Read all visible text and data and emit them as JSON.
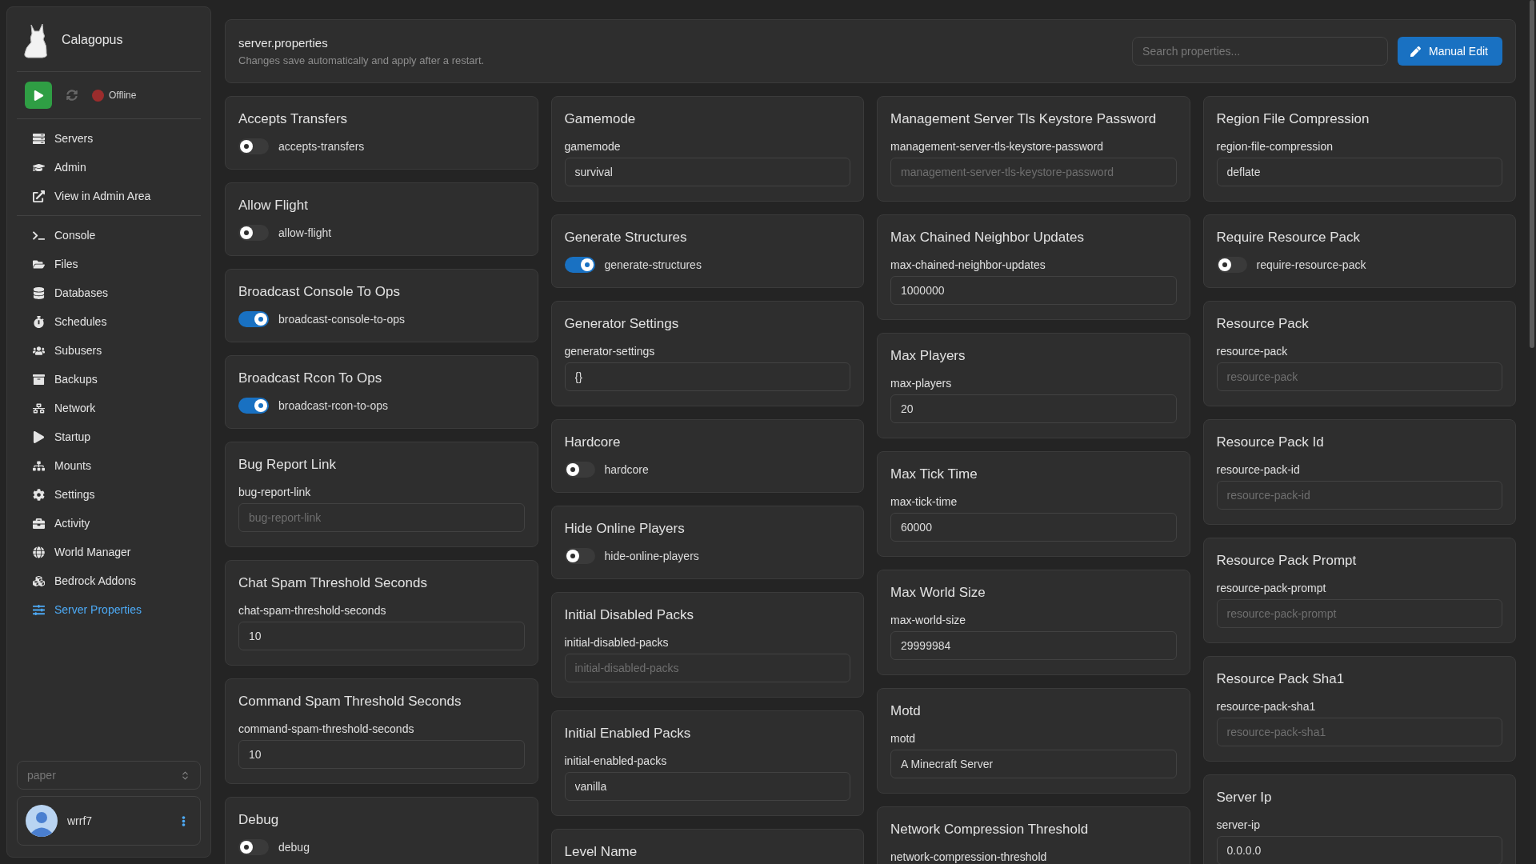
{
  "brand": "Calagopus",
  "power": {
    "status": "Offline"
  },
  "nav_groups": [
    [
      {
        "label": "Servers",
        "selected": false
      },
      {
        "label": "Admin",
        "selected": false
      },
      {
        "label": "View in Admin Area",
        "selected": false
      }
    ],
    [
      {
        "label": "Console",
        "selected": false
      },
      {
        "label": "Files",
        "selected": false
      },
      {
        "label": "Databases",
        "selected": false
      },
      {
        "label": "Schedules",
        "selected": false
      },
      {
        "label": "Subusers",
        "selected": false
      },
      {
        "label": "Backups",
        "selected": false
      },
      {
        "label": "Network",
        "selected": false
      },
      {
        "label": "Startup",
        "selected": false
      },
      {
        "label": "Mounts",
        "selected": false
      },
      {
        "label": "Settings",
        "selected": false
      },
      {
        "label": "Activity",
        "selected": false
      },
      {
        "label": "World Manager",
        "selected": false
      },
      {
        "label": "Bedrock Addons",
        "selected": false
      },
      {
        "label": "Server Properties",
        "selected": true
      }
    ]
  ],
  "server_select": {
    "placeholder": "paper"
  },
  "user": {
    "name": "wrrf7"
  },
  "header": {
    "title": "server.properties",
    "subtitle": "Changes save automatically and apply after a restart.",
    "search_placeholder": "Search properties...",
    "button": "Manual Edit"
  },
  "columns": [
    [
      {
        "kind": "toggle",
        "title": "Accepts Transfers",
        "key": "accepts-transfers",
        "on": false
      },
      {
        "kind": "toggle",
        "title": "Allow Flight",
        "key": "allow-flight",
        "on": false
      },
      {
        "kind": "toggle",
        "title": "Broadcast Console To Ops",
        "key": "broadcast-console-to-ops",
        "on": true
      },
      {
        "kind": "toggle",
        "title": "Broadcast Rcon To Ops",
        "key": "broadcast-rcon-to-ops",
        "on": true
      },
      {
        "kind": "text",
        "title": "Bug Report Link",
        "key": "bug-report-link",
        "placeholder": "bug-report-link"
      },
      {
        "kind": "text",
        "title": "Chat Spam Threshold Seconds",
        "key": "chat-spam-threshold-seconds",
        "value": "10"
      },
      {
        "kind": "text",
        "title": "Command Spam Threshold Seconds",
        "key": "command-spam-threshold-seconds",
        "value": "10"
      },
      {
        "kind": "toggle",
        "title": "Debug",
        "key": "debug",
        "on": false
      }
    ],
    [
      {
        "kind": "text",
        "title": "Gamemode",
        "key": "gamemode",
        "value": "survival"
      },
      {
        "kind": "toggle",
        "title": "Generate Structures",
        "key": "generate-structures",
        "on": true
      },
      {
        "kind": "text",
        "title": "Generator Settings",
        "key": "generator-settings",
        "value": "{}"
      },
      {
        "kind": "toggle",
        "title": "Hardcore",
        "key": "hardcore",
        "on": false
      },
      {
        "kind": "toggle",
        "title": "Hide Online Players",
        "key": "hide-online-players",
        "on": false
      },
      {
        "kind": "text",
        "title": "Initial Disabled Packs",
        "key": "initial-disabled-packs",
        "placeholder": "initial-disabled-packs"
      },
      {
        "kind": "text",
        "title": "Initial Enabled Packs",
        "key": "initial-enabled-packs",
        "value": "vanilla"
      },
      {
        "kind": "text",
        "title": "Level Name"
      }
    ],
    [
      {
        "kind": "text",
        "title": "Management Server Tls Keystore Password",
        "key": "management-server-tls-keystore-password",
        "placeholder": "management-server-tls-keystore-password"
      },
      {
        "kind": "text",
        "title": "Max Chained Neighbor Updates",
        "key": "max-chained-neighbor-updates",
        "value": "1000000"
      },
      {
        "kind": "text",
        "title": "Max Players",
        "key": "max-players",
        "value": "20"
      },
      {
        "kind": "text",
        "title": "Max Tick Time",
        "key": "max-tick-time",
        "value": "60000"
      },
      {
        "kind": "text",
        "title": "Max World Size",
        "key": "max-world-size",
        "value": "29999984"
      },
      {
        "kind": "text",
        "title": "Motd",
        "key": "motd",
        "value": "A Minecraft Server"
      },
      {
        "kind": "text",
        "title": "Network Compression Threshold",
        "key": "network-compression-threshold"
      }
    ],
    [
      {
        "kind": "text",
        "title": "Region File Compression",
        "key": "region-file-compression",
        "value": "deflate"
      },
      {
        "kind": "toggle",
        "title": "Require Resource Pack",
        "key": "require-resource-pack",
        "on": false
      },
      {
        "kind": "text",
        "title": "Resource Pack",
        "key": "resource-pack",
        "placeholder": "resource-pack"
      },
      {
        "kind": "text",
        "title": "Resource Pack Id",
        "key": "resource-pack-id",
        "placeholder": "resource-pack-id"
      },
      {
        "kind": "text",
        "title": "Resource Pack Prompt",
        "key": "resource-pack-prompt",
        "placeholder": "resource-pack-prompt"
      },
      {
        "kind": "text",
        "title": "Resource Pack Sha1",
        "key": "resource-pack-sha1",
        "placeholder": "resource-pack-sha1"
      },
      {
        "kind": "text",
        "title": "Server Ip",
        "key": "server-ip",
        "value": "0.0.0.0"
      }
    ]
  ]
}
